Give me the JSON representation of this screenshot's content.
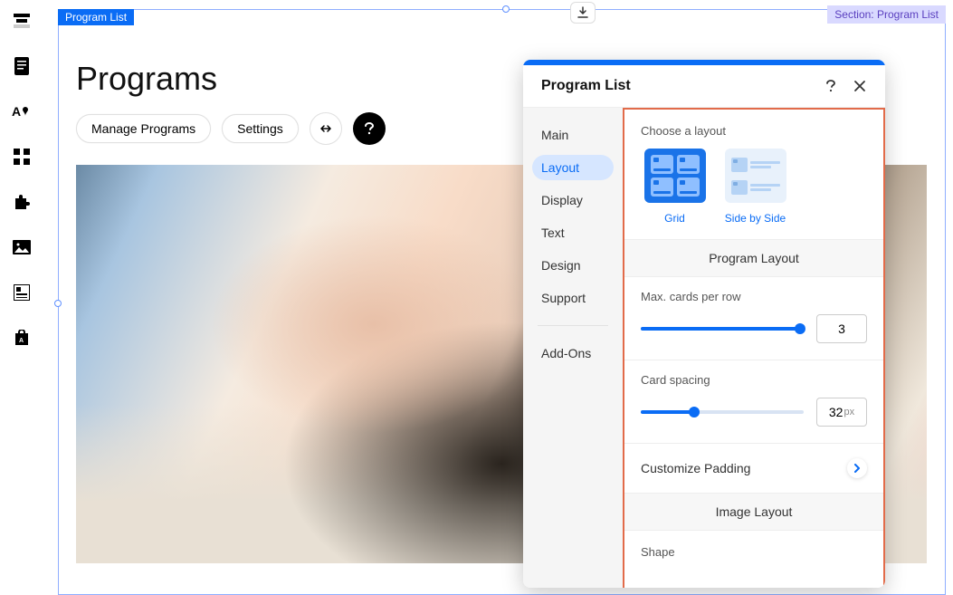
{
  "section": {
    "label": "Program List",
    "tag": "Section: Program List"
  },
  "page": {
    "title": "Programs"
  },
  "toolbar": {
    "manage": "Manage Programs",
    "settings": "Settings"
  },
  "panel": {
    "title": "Program List",
    "nav": {
      "main": "Main",
      "layout": "Layout",
      "display": "Display",
      "text": "Text",
      "design": "Design",
      "support": "Support",
      "addons": "Add-Ons"
    },
    "layout": {
      "choose_label": "Choose a layout",
      "grid_label": "Grid",
      "side_label": "Side by Side",
      "program_layout_header": "Program Layout",
      "max_cards_label": "Max. cards per row",
      "max_cards_value": "3",
      "spacing_label": "Card spacing",
      "spacing_value": "32",
      "spacing_unit": "px",
      "padding_label": "Customize Padding",
      "image_layout_header": "Image Layout",
      "shape_label": "Shape"
    }
  },
  "sliders": {
    "max_cards_fill_pct": 98,
    "spacing_fill_pct": 33
  }
}
